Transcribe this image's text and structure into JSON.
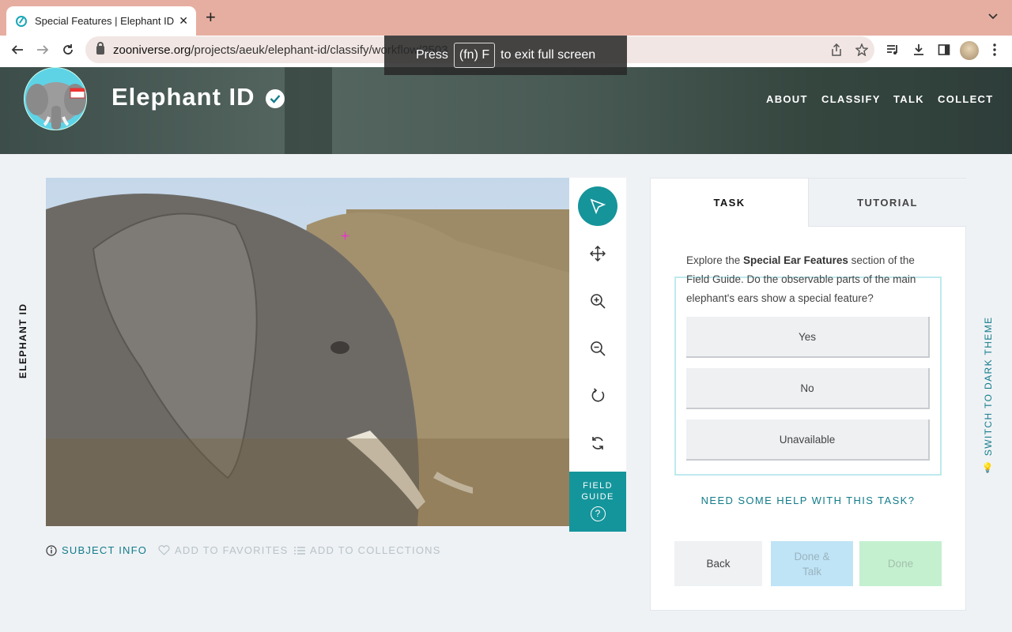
{
  "browser": {
    "tab_title": "Special Features | Elephant ID",
    "url_domain": "zooniverse.org",
    "url_path": "/projects/aeuk/elephant-id/classify/workflow/2503",
    "fullscreen_notice": {
      "before": "Press",
      "key": "(fn) F",
      "after": "to exit full screen"
    }
  },
  "project": {
    "title": "Elephant ID",
    "nav": [
      "ABOUT",
      "CLASSIFY",
      "TALK",
      "COLLECT"
    ],
    "side_label": "ELEPHANT ID",
    "theme_toggle": "SWITCH TO DARK THEME"
  },
  "viewer": {
    "field_guide_line1": "FIELD",
    "field_guide_line2": "GUIDE",
    "field_guide_icon": "?",
    "subject_info": "SUBJECT INFO",
    "add_favorites": "ADD TO FAVORITES",
    "add_collections": "ADD TO COLLECTIONS"
  },
  "task_panel": {
    "tab_task": "TASK",
    "tab_tutorial": "TUTORIAL",
    "question_pre": "Explore the ",
    "question_bold": "Special Ear Features",
    "question_post": " section of the Field Guide. Do the observable parts of the main elephant's ears show a special feature?",
    "answers": [
      "Yes",
      "No",
      "Unavailable"
    ],
    "help": "NEED SOME HELP WITH THIS TASK?",
    "back": "Back",
    "done_talk_1": "Done &",
    "done_talk_2": "Talk",
    "done": "Done"
  },
  "colors": {
    "accent": "#15949a",
    "tab_bar": "#e6aea1",
    "done": "#c4f0d0",
    "done_talk": "#bfe4f6"
  }
}
